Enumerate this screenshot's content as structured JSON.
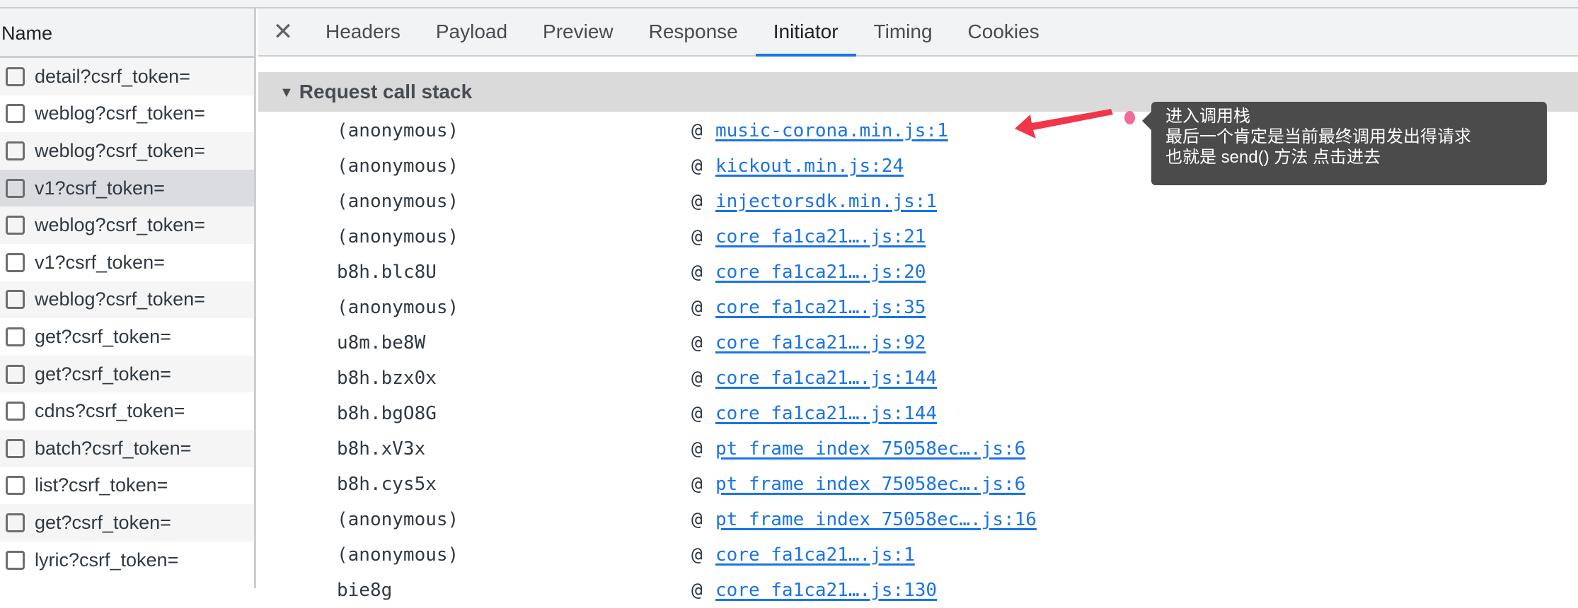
{
  "left_panel": {
    "header": "Name",
    "selected_index": 3,
    "requests": [
      "detail?csrf_token=",
      "weblog?csrf_token=",
      "weblog?csrf_token=",
      "v1?csrf_token=",
      "weblog?csrf_token=",
      "v1?csrf_token=",
      "weblog?csrf_token=",
      "get?csrf_token=",
      "get?csrf_token=",
      "cdns?csrf_token=",
      "batch?csrf_token=",
      "list?csrf_token=",
      "get?csrf_token=",
      "lyric?csrf_token="
    ]
  },
  "tabs": {
    "close": "✕",
    "items": [
      "Headers",
      "Payload",
      "Preview",
      "Response",
      "Initiator",
      "Timing",
      "Cookies"
    ],
    "active": "Initiator"
  },
  "section": {
    "title": "Request call stack"
  },
  "call_stack": [
    {
      "fn": "(anonymous)",
      "src": "music-corona.min.js:1"
    },
    {
      "fn": "(anonymous)",
      "src": "kickout.min.js:24"
    },
    {
      "fn": "(anonymous)",
      "src": "injectorsdk.min.js:1"
    },
    {
      "fn": "(anonymous)",
      "src": "core_fa1ca21….js:21"
    },
    {
      "fn": "b8h.blc8U",
      "src": "core_fa1ca21….js:20"
    },
    {
      "fn": "(anonymous)",
      "src": "core_fa1ca21….js:35"
    },
    {
      "fn": "u8m.be8W",
      "src": "core_fa1ca21….js:92"
    },
    {
      "fn": "b8h.bzx0x",
      "src": "core_fa1ca21….js:144"
    },
    {
      "fn": "b8h.bgO8G",
      "src": "core_fa1ca21….js:144"
    },
    {
      "fn": "b8h.xV3x",
      "src": "pt_frame_index_75058ec….js:6"
    },
    {
      "fn": "b8h.cys5x",
      "src": "pt_frame_index_75058ec….js:6"
    },
    {
      "fn": "(anonymous)",
      "src": "pt_frame_index_75058ec….js:16"
    },
    {
      "fn": "(anonymous)",
      "src": "core_fa1ca21….js:1"
    },
    {
      "fn": "bie8g",
      "src": "core_fa1ca21….js:130"
    }
  ],
  "annotation": {
    "lines": [
      "进入调用栈",
      "最后一个肯定是当前最终调用发出得请求",
      "也就是 send() 方法 点击进去"
    ]
  },
  "colors": {
    "accent": "#1a73e8",
    "arrow": "#f0374a",
    "tooltip_bg": "#4b4b4b"
  }
}
